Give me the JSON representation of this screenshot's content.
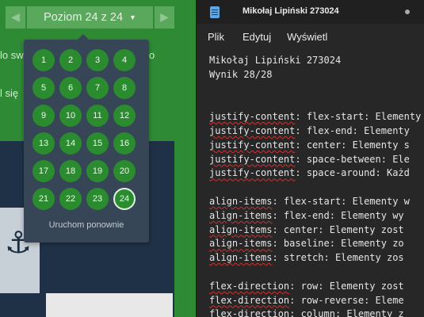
{
  "game": {
    "level_label": "Poziom 24 z 24",
    "prev_icon": "triangle-left-icon",
    "next_icon": "triangle-right-icon",
    "caret_icon": "caret-down-icon",
    "bg_fragment_1_left": "lo sw",
    "bg_fragment_1_right": "o",
    "bg_fragment_2": "l się",
    "levels": [
      "1",
      "2",
      "3",
      "4",
      "5",
      "6",
      "7",
      "8",
      "9",
      "10",
      "11",
      "12",
      "13",
      "14",
      "15",
      "16",
      "17",
      "18",
      "19",
      "20",
      "21",
      "22",
      "23",
      "24"
    ],
    "current_level": "24",
    "restart_label": "Uruchom ponownie",
    "colors": {
      "green": "#2f8a35",
      "level_green": "#2a8c2e",
      "dropdown": "#364656",
      "board": "#1e3146"
    }
  },
  "notepad": {
    "tab_title": "Mikołaj Lipiński 273024",
    "menu": [
      "Plik",
      "Edytuj",
      "Wyświetl"
    ],
    "lines": [
      {
        "prop": "",
        "rest": "Mikołaj Lipiński 273024"
      },
      {
        "prop": "",
        "rest": "Wynik 28/28"
      },
      {
        "prop": "",
        "rest": ""
      },
      {
        "prop": "",
        "rest": ""
      },
      {
        "prop": "justify-content",
        "rest": ": flex-start: Elementy"
      },
      {
        "prop": "justify-content",
        "rest": ": flex-end: Elementy"
      },
      {
        "prop": "justify-content",
        "rest": ": center: Elementy s"
      },
      {
        "prop": "justify-content",
        "rest": ": space-between: Ele"
      },
      {
        "prop": "justify-content",
        "rest": ": space-around: Każd"
      },
      {
        "prop": "",
        "rest": ""
      },
      {
        "prop": "align-items",
        "rest": ": flex-start: Elementy w"
      },
      {
        "prop": "align-items",
        "rest": ": flex-end: Elementy wy"
      },
      {
        "prop": "align-items",
        "rest": ": center: Elementy zost"
      },
      {
        "prop": "align-items",
        "rest": ": baseline: Elementy zo"
      },
      {
        "prop": "align-items",
        "rest": ": stretch: Elementy zos"
      },
      {
        "prop": "",
        "rest": ""
      },
      {
        "prop": "flex-direction",
        "rest": ": row: Elementy zost"
      },
      {
        "prop": "flex-direction",
        "rest": ": row-reverse: Eleme"
      },
      {
        "prop": "flex-direction",
        "rest": ": column: Elementy z"
      }
    ]
  }
}
